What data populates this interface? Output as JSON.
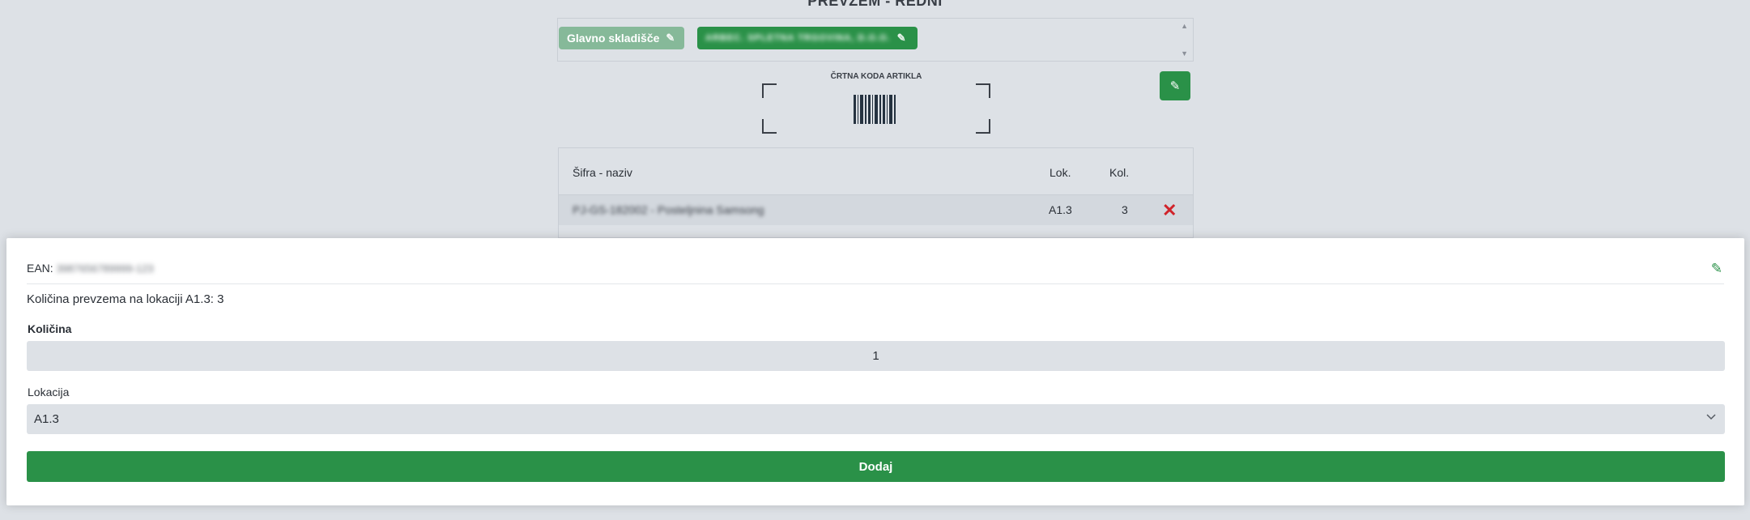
{
  "page": {
    "title": "PREVZEM - REDNI"
  },
  "header": {
    "warehouse_label": "Glavno skladišče",
    "supplier_label": "ARBEC. SPLETNA TRGOVINA, D.O.O.",
    "warehouse_color": "#86b999",
    "supplier_color": "#2a9148"
  },
  "scanner": {
    "label": "ČRTNA KODA ARTIKLA"
  },
  "table": {
    "columns": [
      "Šifra - naziv",
      "Lok.",
      "Kol."
    ],
    "rows": [
      {
        "name": "PJ-GS-182002 - Posteljnina Samsong",
        "location": "A1.3",
        "quantity": "3"
      }
    ]
  },
  "sheet": {
    "ean_label": "EAN:",
    "ean_value": "3987656789999-123",
    "quantity_info": "Količina prevzema na lokaciji A1.3: 3",
    "quantity_label": "Količina",
    "quantity_value": "1",
    "location_label": "Lokacija",
    "location_value": "A1.3",
    "add_label": "Dodaj"
  },
  "colors": {
    "accent": "#2a9148",
    "danger": "#d0232a"
  }
}
